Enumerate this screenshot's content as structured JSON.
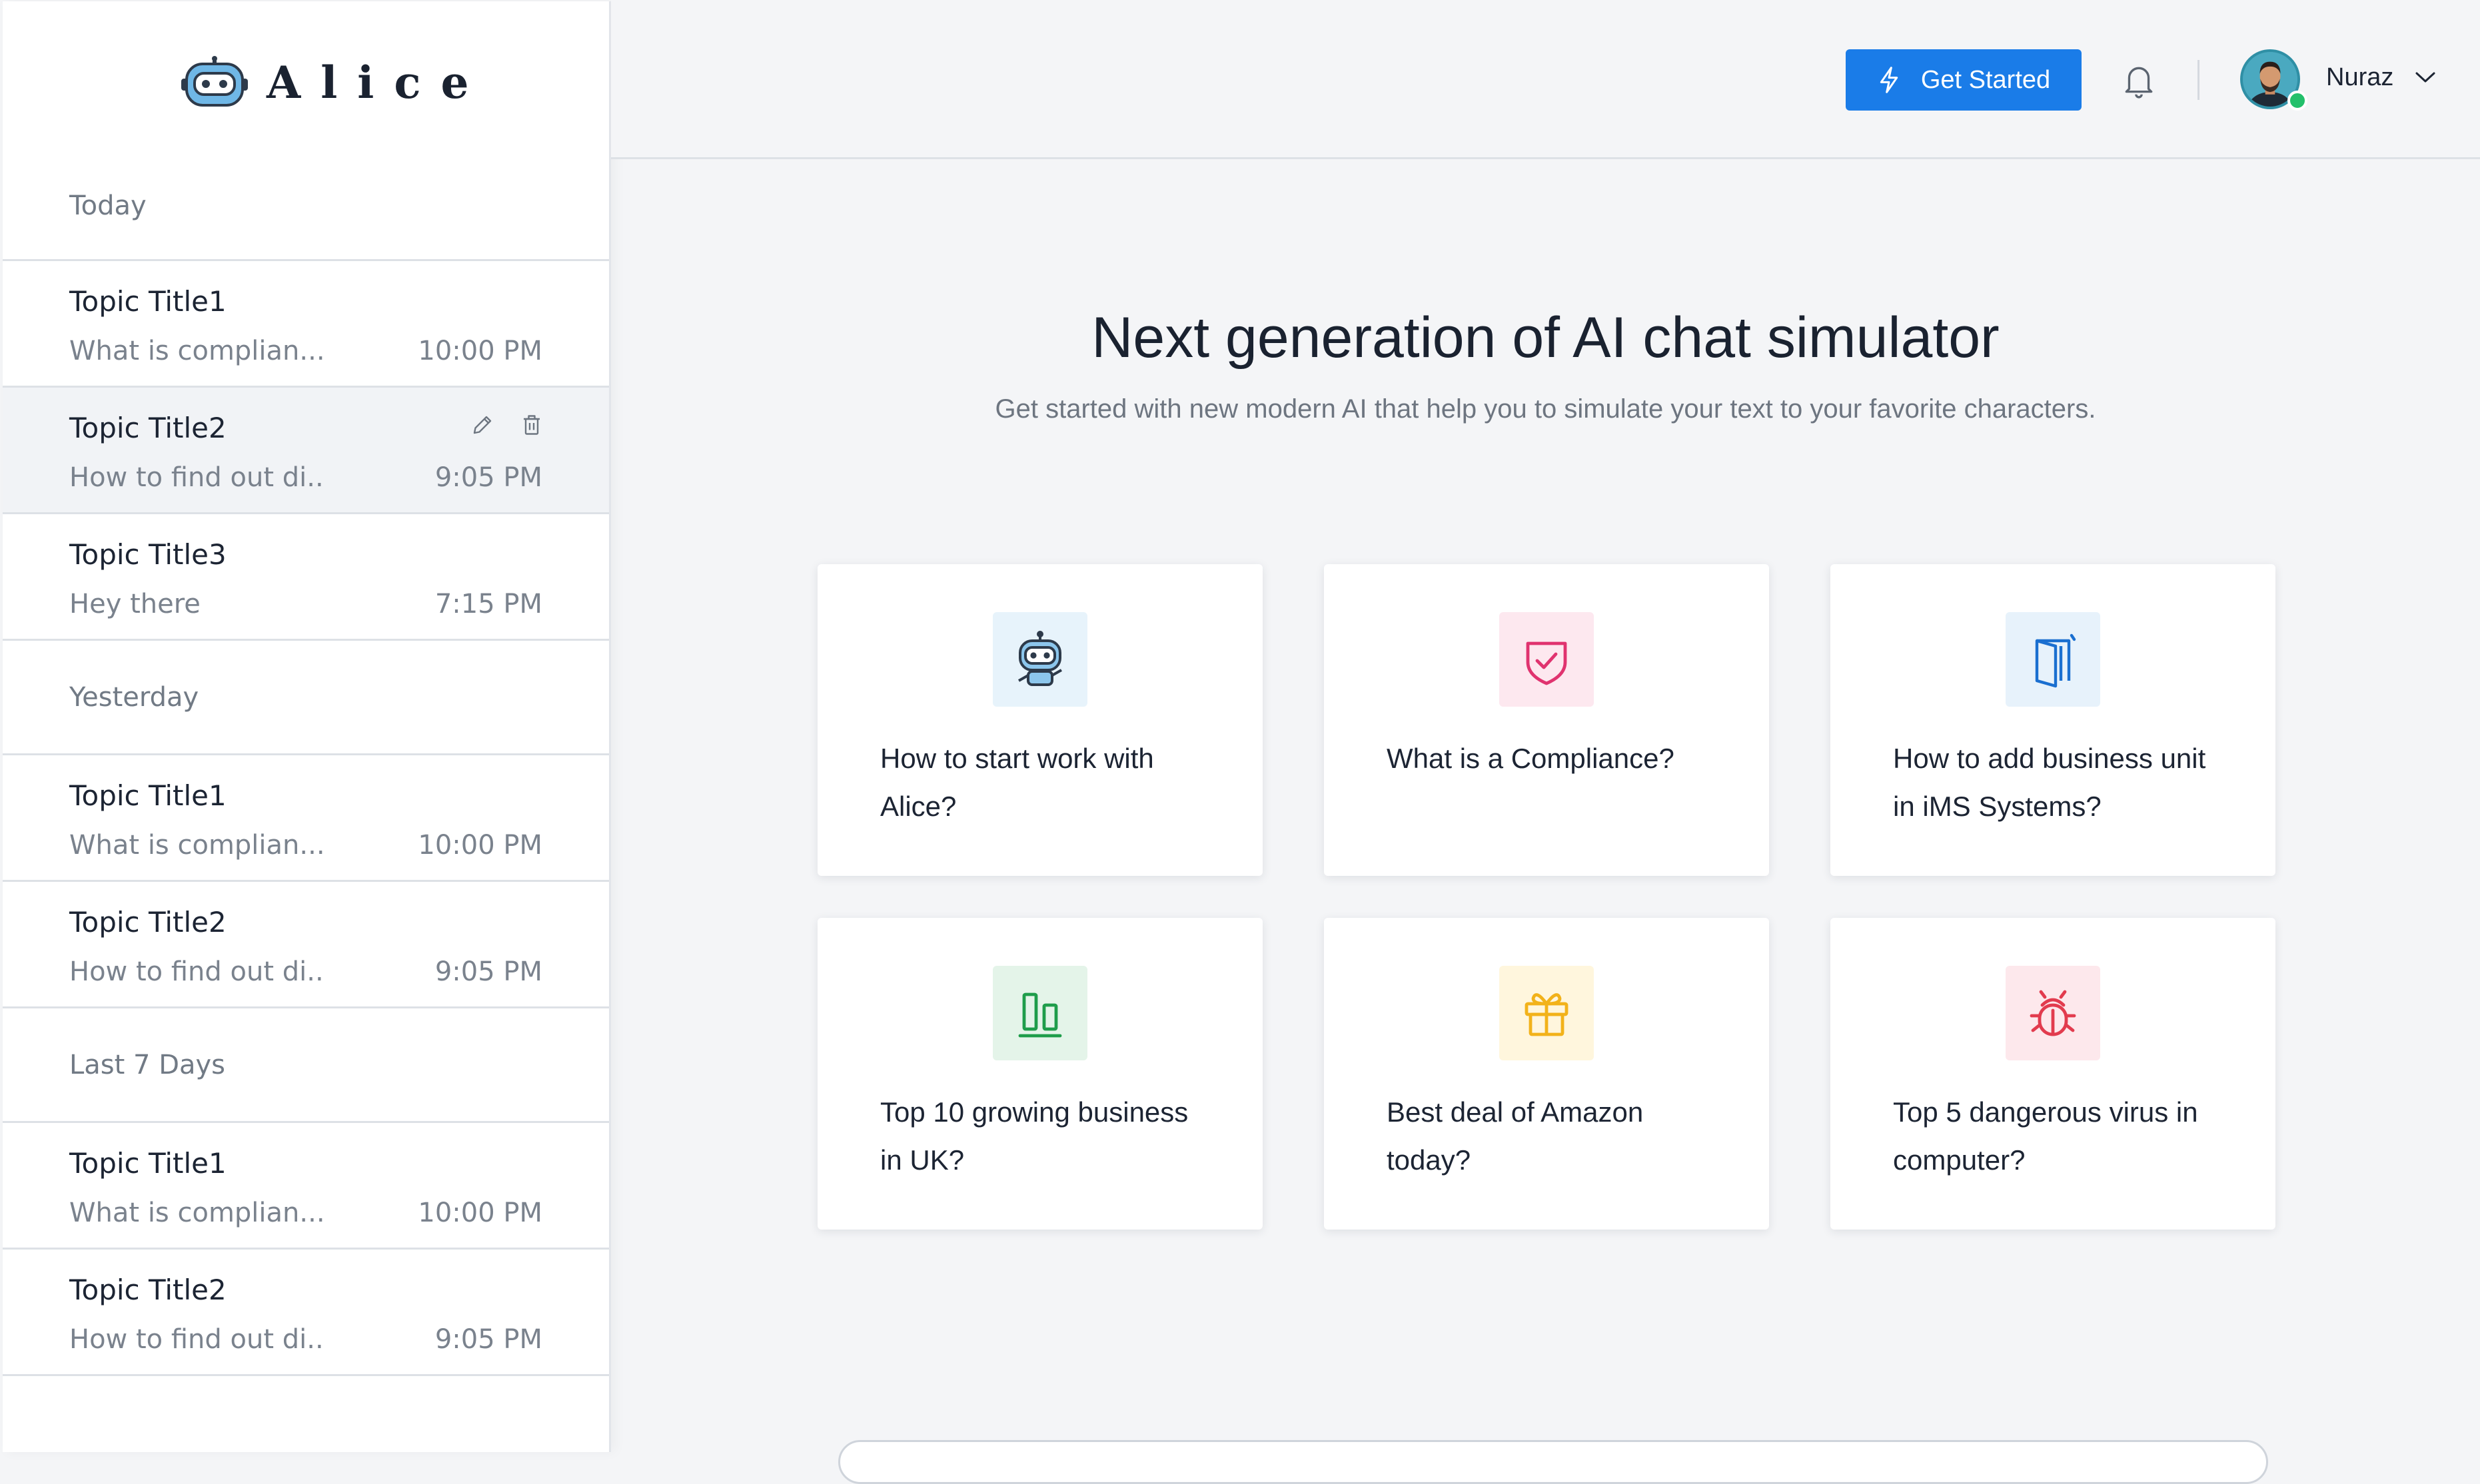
{
  "app": {
    "name": "Alice"
  },
  "sidebar": {
    "groups": [
      {
        "label": "Today",
        "chats": [
          {
            "title": "Topic Title1",
            "preview": "What is complian...",
            "time": "10:00 PM"
          },
          {
            "title": "Topic Title2",
            "preview": "How to find out di..",
            "time": "9:05 PM"
          },
          {
            "title": "Topic Title3",
            "preview": "Hey there",
            "time": "7:15 PM"
          }
        ]
      },
      {
        "label": "Yesterday",
        "chats": [
          {
            "title": "Topic Title1",
            "preview": "What is complian...",
            "time": "10:00 PM"
          },
          {
            "title": "Topic Title2",
            "preview": "How to find out di..",
            "time": "9:05 PM"
          }
        ]
      },
      {
        "label": "Last 7 Days",
        "chats": [
          {
            "title": "Topic Title1",
            "preview": "What is complian...",
            "time": "10:00 PM"
          },
          {
            "title": "Topic Title2",
            "preview": "How to find out di..",
            "time": "9:05 PM"
          }
        ]
      }
    ]
  },
  "header": {
    "cta_label": "Get Started",
    "user": {
      "name": "Nuraz",
      "status": "online"
    },
    "icons": {
      "cta": "bolt-icon",
      "notifications": "bell-icon",
      "menu": "chevron-down-icon"
    }
  },
  "hero": {
    "title": "Next generation of AI chat simulator",
    "subtitle": "Get started with new modern AI that help you to simulate your text to your favorite characters."
  },
  "cards": [
    {
      "text": "How to start work with Alice?",
      "icon": "robot-icon",
      "tint": "#e7f3fb"
    },
    {
      "text": "What is a Compliance?",
      "icon": "shield-check-icon",
      "tint": "#fde8ef"
    },
    {
      "text": "How to add business unit in iMS Systems?",
      "icon": "door-icon",
      "tint": "#e7f2fb"
    },
    {
      "text": "Top 10 growing business in UK?",
      "icon": "bar-chart-icon",
      "tint": "#e4f4e9"
    },
    {
      "text": "Best deal of Amazon today?",
      "icon": "gift-icon",
      "tint": "#fff6dd"
    },
    {
      "text": "Top 5 dangerous virus in computer?",
      "icon": "bug-icon",
      "tint": "#fde8ec"
    }
  ],
  "colors": {
    "accent": "#1a7ce8",
    "shield": "#e0336f",
    "door": "#1a6fd0",
    "chart": "#1f9d4b",
    "gift": "#f2b21a",
    "bug": "#e23b4e"
  }
}
